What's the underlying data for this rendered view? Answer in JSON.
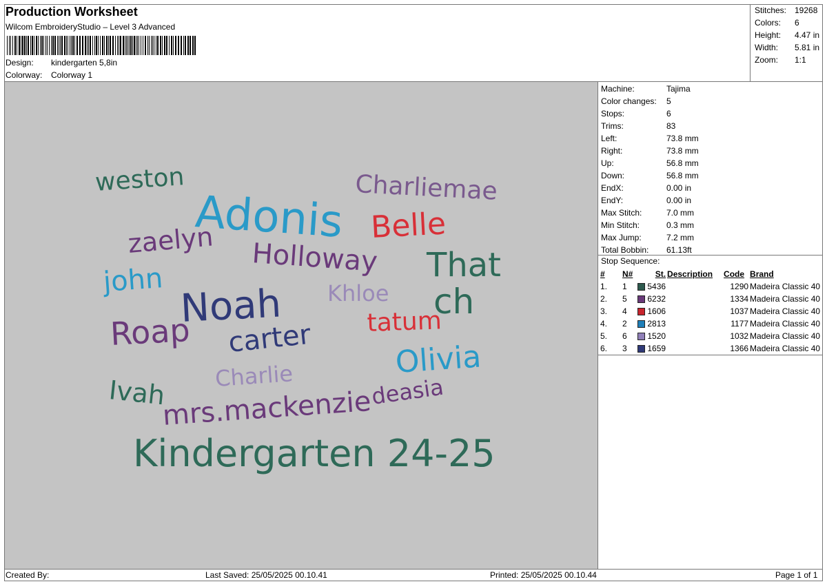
{
  "header": {
    "title": "Production Worksheet",
    "subtitle": "Wilcom EmbroideryStudio – Level 3 Advanced",
    "design_label": "Design:",
    "design_value": "kindergarten 5,8in",
    "colorway_label": "Colorway:",
    "colorway_value": "Colorway 1"
  },
  "stats": [
    {
      "label": "Stitches:",
      "value": "19268"
    },
    {
      "label": "Colors:",
      "value": "6"
    },
    {
      "label": "Height:",
      "value": "4.47 in"
    },
    {
      "label": "Width:",
      "value": "5.81 in"
    },
    {
      "label": "Zoom:",
      "value": "1:1"
    }
  ],
  "machine": [
    {
      "label": "Machine:",
      "value": "Tajima"
    },
    {
      "label": "Color changes:",
      "value": "5"
    },
    {
      "label": "Stops:",
      "value": "6"
    },
    {
      "label": "Trims:",
      "value": "83"
    },
    {
      "label": "Left:",
      "value": "73.8 mm"
    },
    {
      "label": "Right:",
      "value": "73.8 mm"
    },
    {
      "label": "Up:",
      "value": "56.8 mm"
    },
    {
      "label": "Down:",
      "value": "56.8 mm"
    },
    {
      "label": "EndX:",
      "value": "0.00 in"
    },
    {
      "label": "EndY:",
      "value": "0.00 in"
    },
    {
      "label": "Max Stitch:",
      "value": "7.0 mm"
    },
    {
      "label": "Min Stitch:",
      "value": "0.3 mm"
    },
    {
      "label": "Max Jump:",
      "value": "7.2 mm"
    },
    {
      "label": "Total Bobbin:",
      "value": "61.13ft"
    }
  ],
  "stop_sequence": {
    "title": "Stop Sequence:",
    "headers": [
      "#",
      "N#",
      "St.",
      "Description",
      "Code",
      "Brand"
    ],
    "rows": [
      {
        "num": "1.",
        "n": "1",
        "color": "#2e5a4e",
        "st": "5436",
        "desc": "",
        "code": "1290",
        "brand": "Madeira Classic 40"
      },
      {
        "num": "2.",
        "n": "5",
        "color": "#6a3a7a",
        "st": "6232",
        "desc": "",
        "code": "1334",
        "brand": "Madeira Classic 40"
      },
      {
        "num": "3.",
        "n": "4",
        "color": "#c8252e",
        "st": "1606",
        "desc": "",
        "code": "1037",
        "brand": "Madeira Classic 40"
      },
      {
        "num": "4.",
        "n": "2",
        "color": "#1f7fb8",
        "st": "2813",
        "desc": "",
        "code": "1177",
        "brand": "Madeira Classic 40"
      },
      {
        "num": "5.",
        "n": "6",
        "color": "#9080b8",
        "st": "1520",
        "desc": "",
        "code": "1032",
        "brand": "Madeira Classic 40"
      },
      {
        "num": "6.",
        "n": "3",
        "color": "#303a78",
        "st": "1659",
        "desc": "",
        "code": "1366",
        "brand": "Madeira Classic 40"
      }
    ]
  },
  "design_words": [
    {
      "text": "weston",
      "color": "#2e6a58"
    },
    {
      "text": "Adonis",
      "color": "#2a9ac8"
    },
    {
      "text": "Charliemae",
      "color": "#7a5a8e"
    },
    {
      "text": "Belle",
      "color": "#d83038"
    },
    {
      "text": "zaelyn",
      "color": "#6a3a7a"
    },
    {
      "text": "Holloway",
      "color": "#6a3a7a"
    },
    {
      "text": "That",
      "color": "#2e6a58"
    },
    {
      "text": "john",
      "color": "#2a9ac8"
    },
    {
      "text": "Khloe",
      "color": "#9a8ab8"
    },
    {
      "text": "ch",
      "color": "#2e6a58"
    },
    {
      "text": "Roap",
      "color": "#6a3a7a"
    },
    {
      "text": "Noah",
      "color": "#303a78"
    },
    {
      "text": "tatum",
      "color": "#d83038"
    },
    {
      "text": "carter",
      "color": "#303a78"
    },
    {
      "text": "Olivia",
      "color": "#2a9ac8"
    },
    {
      "text": "Ivah",
      "color": "#2e6a58"
    },
    {
      "text": "Charlie",
      "color": "#9a8ab8"
    },
    {
      "text": "deasia",
      "color": "#6a3a7a"
    },
    {
      "text": "mrs.mackenzie",
      "color": "#6a3a7a"
    },
    {
      "text": "Kindergarten 24-25",
      "color": "#2e6a58"
    }
  ],
  "footer": {
    "created_by": "Created By:",
    "last_saved": "Last Saved: 25/05/2025 00.10.41",
    "printed": "Printed: 25/05/2025 00.10.44",
    "page": "Page 1 of 1"
  }
}
